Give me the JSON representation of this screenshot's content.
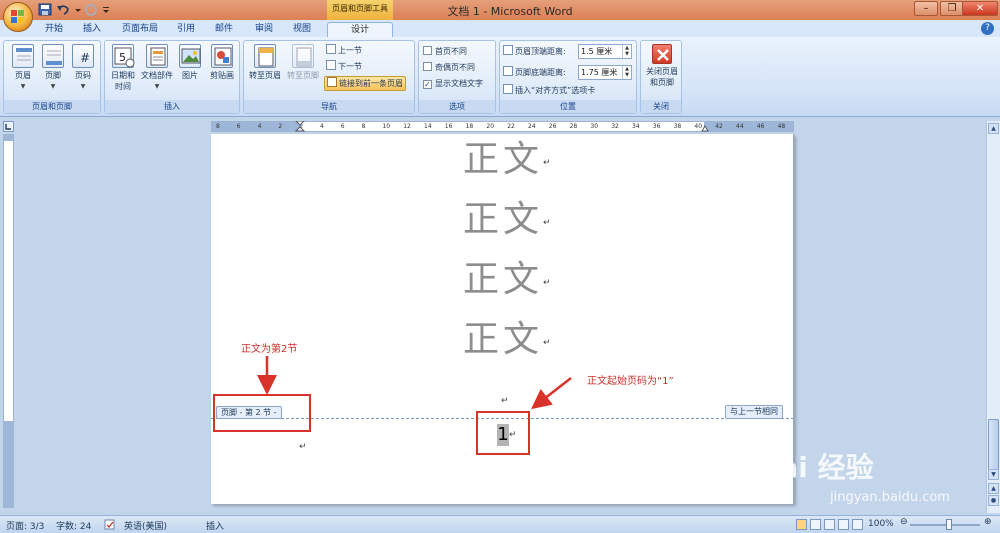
{
  "title_bar": {
    "title": "文档 1 - Microsoft Word",
    "context_tab_group": "页眉和页脚工具",
    "window_buttons": [
      "–",
      "❐",
      "✕"
    ]
  },
  "tabs": [
    {
      "label": "开始"
    },
    {
      "label": "插入"
    },
    {
      "label": "页面布局"
    },
    {
      "label": "引用"
    },
    {
      "label": "邮件"
    },
    {
      "label": "审阅"
    },
    {
      "label": "视图"
    },
    {
      "label": "设计",
      "active": true
    }
  ],
  "ribbon": {
    "group_header_footer": {
      "label": "页眉和页脚",
      "buttons": [
        "页眉",
        "页脚",
        "页码"
      ]
    },
    "group_insert": {
      "label": "插入",
      "date_time": [
        "日期和",
        "时间"
      ],
      "doc_parts": "文档部件",
      "picture": "图片",
      "clipart": "剪贴画"
    },
    "group_nav": {
      "label": "导航",
      "goto_header": "转至页眉",
      "goto_footer": "转至页脚",
      "prev_section": "上一节",
      "next_section": "下一节",
      "link_previous": "链接到前一条页眉"
    },
    "group_options": {
      "label": "选项",
      "different_first": "首页不同",
      "different_odd_even": "奇偶页不同",
      "show_doc_text": "显示文档文字",
      "show_doc_text_checked": true
    },
    "group_position": {
      "label": "位置",
      "header_top_label": "页眉顶端距离:",
      "header_top_value": "1.5 厘米",
      "footer_bottom_label": "页脚底端距离:",
      "footer_bottom_value": "1.75 厘米",
      "insert_align_tab": "插入“对齐方式”选项卡"
    },
    "group_close": {
      "label": "关闭",
      "close_button": [
        "关闭页眉",
        "和页脚"
      ]
    }
  },
  "ruler_ticks": [
    "8",
    "6",
    "4",
    "2",
    "2",
    "4",
    "6",
    "8",
    "10",
    "12",
    "14",
    "16",
    "18",
    "20",
    "22",
    "24",
    "26",
    "28",
    "30",
    "32",
    "34",
    "36",
    "38",
    "40",
    "42",
    "44",
    "46",
    "48"
  ],
  "document": {
    "body_lines": [
      "正文",
      "正文",
      "正文",
      "正文"
    ],
    "paragraph_mark": "↵",
    "footer_tag": "页脚 - 第 2 节 -",
    "same_as_previous_tag": "与上一节相同",
    "page_number": "1"
  },
  "annotations": {
    "left_note": "正文为第2节",
    "right_note": "正文起始页码为“1”",
    "color": "#d9322a"
  },
  "status_bar": {
    "page": "页面: 3/3",
    "words": "字数: 24",
    "language": "英语(美国)",
    "mode": "插入",
    "zoom": "100%",
    "zoom_level_percent": 100
  },
  "watermark": {
    "brand": "Bai 经验",
    "url": "jingyan.baidu.com"
  }
}
